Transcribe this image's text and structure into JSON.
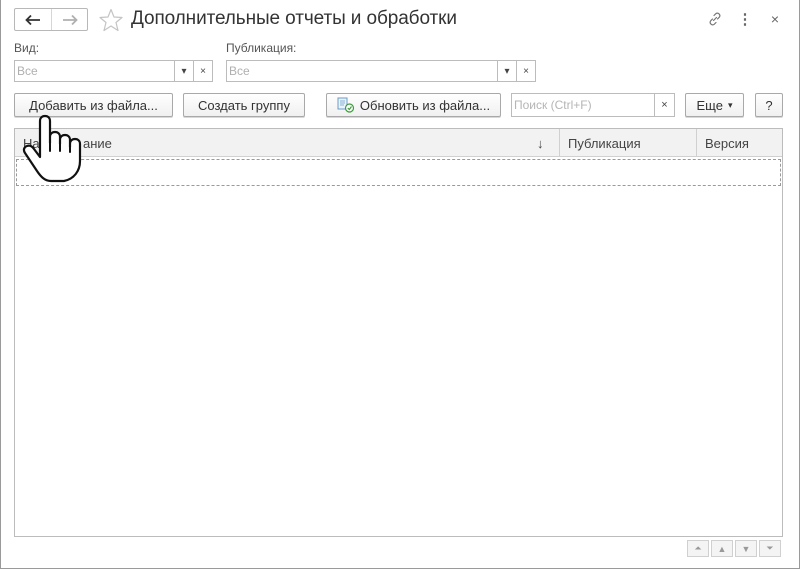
{
  "header": {
    "title": "Дополнительные отчеты и обработки",
    "back_icon": "arrow-left-icon",
    "forward_icon": "arrow-right-icon",
    "favorite_icon": "star-icon",
    "link_icon": "link-icon",
    "more_icon": "more-vertical-icon",
    "close_icon": "close-icon",
    "close_glyph": "×",
    "more_glyph": "⋮"
  },
  "filters": {
    "kind_label": "Вид:",
    "kind_value": "Все",
    "publication_label": "Публикация:",
    "publication_value": "Все",
    "dropdown_glyph": "▾",
    "clear_glyph": "×"
  },
  "toolbar": {
    "add_from_file": "Добавить из файла...",
    "create_group": "Создать группу",
    "update_from_file": "Обновить из файла...",
    "search_placeholder": "Поиск (Ctrl+F)",
    "search_clear": "×",
    "more": "Еще",
    "more_arrow": "▾",
    "help": "?"
  },
  "table": {
    "columns": [
      {
        "label": "Наименование",
        "visible_label_part": "ание",
        "sort": "↓"
      },
      {
        "label": "Публикация"
      },
      {
        "label": "Версия"
      }
    ],
    "rows": []
  },
  "pagination": {
    "first_glyph": "⏶",
    "prev_glyph": "▲",
    "next_glyph": "▼",
    "last_glyph": "⏷"
  },
  "colors": {
    "accent": "#4a90d9",
    "border": "#bcbcbc",
    "header_bg": "#f2f2f2"
  }
}
